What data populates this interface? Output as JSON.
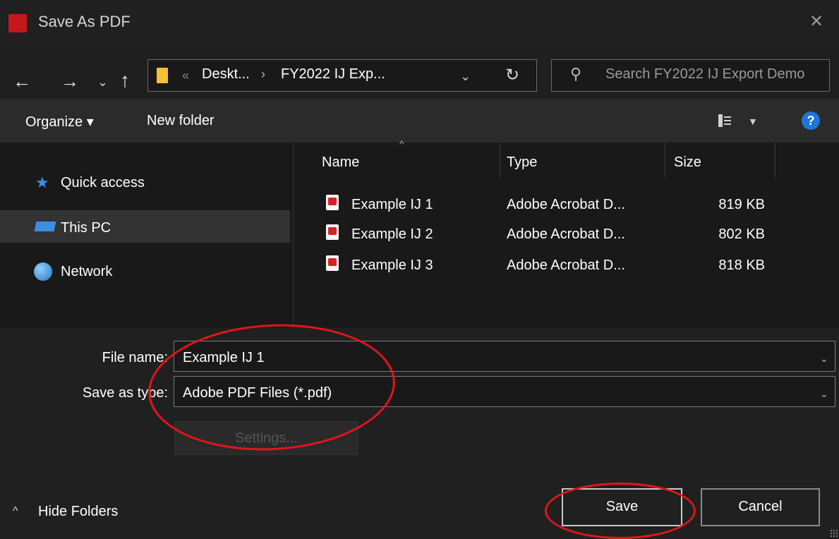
{
  "window": {
    "title": "Save As PDF",
    "close_glyph": "✕"
  },
  "nav": {
    "back_glyph": "←",
    "forward_glyph": "→",
    "recent_glyph": "⌄",
    "up_glyph": "↑",
    "refresh_glyph": "↻"
  },
  "address": {
    "overflow_glyph": "«",
    "breadcrumbs": [
      "Deskt...",
      "FY2022 IJ Exp..."
    ],
    "separator": "›",
    "dropdown_glyph": "⌄"
  },
  "search": {
    "placeholder": "Search FY2022 IJ Export Demo",
    "icon_glyph": "⚲"
  },
  "toolbar": {
    "organize_label": "Organize ▾",
    "new_folder_label": "New folder",
    "view_chevron": "▼",
    "help_label": "?"
  },
  "sidebar": {
    "items": [
      {
        "label": "Quick access",
        "icon": "star-icon",
        "glyph": "★"
      },
      {
        "label": "This PC",
        "icon": "computer-icon",
        "selected": true
      },
      {
        "label": "Network",
        "icon": "network-icon"
      }
    ]
  },
  "filelist": {
    "sort_glyph": "^",
    "columns": [
      "Name",
      "Type",
      "Size"
    ],
    "rows": [
      {
        "name": "Example IJ 1",
        "type": "Adobe Acrobat D...",
        "size": "819 KB"
      },
      {
        "name": "Example IJ 2",
        "type": "Adobe Acrobat D...",
        "size": "802 KB"
      },
      {
        "name": "Example IJ 3",
        "type": "Adobe Acrobat D...",
        "size": "818 KB"
      }
    ]
  },
  "form": {
    "file_name_label": "File name:",
    "file_name_value": "Example IJ 1",
    "save_type_label": "Save as type:",
    "save_type_value": "Adobe PDF Files (*.pdf)",
    "chevron": "⌄",
    "settings_label": "Settings..."
  },
  "footer": {
    "hide_folders_label": "Hide Folders",
    "hide_chevron": "^",
    "save_label": "Save",
    "cancel_label": "Cancel"
  },
  "colors": {
    "annotation": "#e1151b",
    "background": "#1f1f1f",
    "accent": "#1e74d8",
    "pdf_red": "#d32229"
  }
}
